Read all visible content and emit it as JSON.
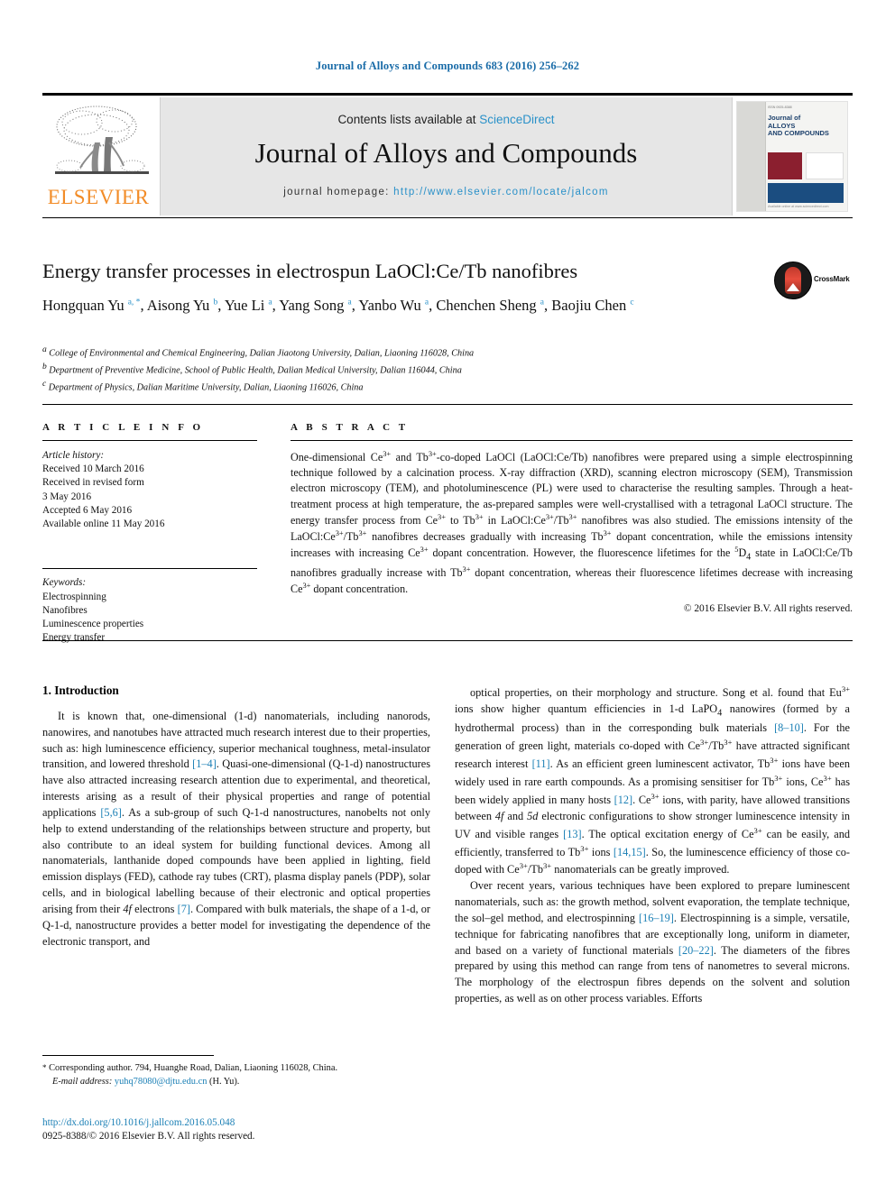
{
  "running_head": "Journal of Alloys and Compounds 683 (2016) 256–262",
  "masthead": {
    "publisher_logo_text": "ELSEVIER",
    "contents_prefix": "Contents lists available at ",
    "contents_link": "ScienceDirect",
    "journal_title": "Journal of Alloys and Compounds",
    "homepage_prefix": "journal homepage: ",
    "homepage_link": "http://www.elsevier.com/locate/jalcom",
    "cover": {
      "top_line": "ISSN 0925-8388",
      "line1": "Journal of",
      "line2": "ALLOYS",
      "line3": "AND COMPOUNDS",
      "foot_line": "Available online at www.sciencedirect.com"
    }
  },
  "article": {
    "title": "Energy transfer processes in electrospun LaOCl:Ce/Tb nanofibres",
    "crossmark_label": "CrossMark",
    "authors": [
      {
        "name": "Hongquan Yu",
        "marks": "a, *"
      },
      {
        "name": "Aisong Yu",
        "marks": "b"
      },
      {
        "name": "Yue Li",
        "marks": "a"
      },
      {
        "name": "Yang Song",
        "marks": "a"
      },
      {
        "name": "Yanbo Wu",
        "marks": "a"
      },
      {
        "name": "Chenchen Sheng",
        "marks": "a"
      },
      {
        "name": "Baojiu Chen",
        "marks": "c"
      }
    ],
    "affiliations": [
      {
        "mark": "a",
        "text": "College of Environmental and Chemical Engineering, Dalian Jiaotong University, Dalian, Liaoning 116028, China"
      },
      {
        "mark": "b",
        "text": "Department of Preventive Medicine, School of Public Health, Dalian Medical University, Dalian 116044, China"
      },
      {
        "mark": "c",
        "text": "Department of Physics, Dalian Maritime University, Dalian, Liaoning 116026, China"
      }
    ]
  },
  "article_info": {
    "heading": "A R T I C L E   I N F O",
    "history_label": "Article history:",
    "history": [
      "Received 10 March 2016",
      "Received in revised form",
      "3 May 2016",
      "Accepted 6 May 2016",
      "Available online 11 May 2016"
    ],
    "keywords_label": "Keywords:",
    "keywords": [
      "Electrospinning",
      "Nanofibres",
      "Luminescence properties",
      "Energy transfer"
    ]
  },
  "abstract": {
    "heading": "A B S T R A C T",
    "text_html": "One-dimensional Ce<sup>3+</sup> and Tb<sup>3+</sup>-co-doped LaOCl (LaOCl:Ce/Tb) nanofibres were prepared using a simple electrospinning technique followed by a calcination process. X-ray diffraction (XRD), scanning electron microscopy (SEM), Transmission electron microscopy (TEM), and photoluminescence (PL) were used to characterise the resulting samples. Through a heat-treatment process at high temperature, the as-prepared samples were well-crystallised with a tetragonal LaOCl structure. The energy transfer process from Ce<sup>3+</sup> to Tb<sup>3+</sup> in LaOCl:Ce<sup>3+</sup>/Tb<sup>3+</sup> nanofibres was also studied. The emissions intensity of the LaOCl:Ce<sup>3+</sup>/Tb<sup>3+</sup> nanofibres decreases gradually with increasing Tb<sup>3+</sup> dopant concentration, while the emissions intensity increases with increasing Ce<sup>3+</sup> dopant concentration. However, the fluorescence lifetimes for the <sup>5</sup>D<sub>4</sub> state in LaOCl:Ce/Tb nanofibres gradually increase with Tb<sup>3+</sup> dopant concentration, whereas their fluorescence lifetimes decrease with increasing Ce<sup>3+</sup> dopant concentration.",
    "copyright": "© 2016 Elsevier B.V. All rights reserved."
  },
  "body": {
    "section_heading": "1.  Introduction",
    "left_paragraphs_html": [
      "It is known that, one-dimensional (1-d) nanomaterials, including nanorods, nanowires, and nanotubes have attracted much research interest due to their properties, such as: high luminescence efficiency, superior mechanical toughness, metal-insulator transition, and lowered threshold <span class=\"ref\">[1–4]</span>. Quasi-one-dimensional (Q-1-d) nanostructures have also attracted increasing research attention due to experimental, and theoretical, interests arising as a result of their physical properties and range of potential applications <span class=\"ref\">[5,6]</span>. As a sub-group of such Q-1-d nanostructures, nanobelts not only help to extend understanding of the relationships between structure and property, but also contribute to an ideal system for building functional devices. Among all nanomaterials, lanthanide doped compounds have been applied in lighting, field emission displays (FED), cathode ray tubes (CRT), plasma display panels (PDP), solar cells, and in biological labelling because of their electronic and optical properties arising from their <span class=\"it\">4f</span> electrons <span class=\"ref\">[7]</span>. Compared with bulk materials, the shape of a 1-d, or Q-1-d, nanostructure provides a better model for investigating the dependence of the electronic transport, and"
    ],
    "right_paragraphs_html": [
      "optical properties, on their morphology and structure. Song et al. found that Eu<sup>3+</sup> ions show higher quantum efficiencies in 1-d LaPO<sub>4</sub> nanowires (formed by a hydrothermal process) than in the corresponding bulk materials <span class=\"ref\">[8–10]</span>. For the generation of green light, materials co-doped with Ce<sup>3+</sup>/Tb<sup>3+</sup> have attracted significant research interest <span class=\"ref\">[11]</span>. As an efficient green luminescent activator, Tb<sup>3+</sup> ions have been widely used in rare earth compounds. As a promising sensitiser for Tb<sup>3+</sup> ions, Ce<sup>3+</sup> has been widely applied in many hosts <span class=\"ref\">[12]</span>. Ce<sup>3+</sup> ions, with parity, have allowed transitions between <span class=\"it\">4f</span> and <span class=\"it\">5d</span> electronic configurations to show stronger luminescence intensity in UV and visible ranges <span class=\"ref\">[13]</span>. The optical excitation energy of Ce<sup>3+</sup> can be easily, and efficiently, transferred to Tb<sup>3+</sup> ions <span class=\"ref\">[14,15]</span>. So, the luminescence efficiency of those co-doped with Ce<sup>3+</sup>/Tb<sup>3+</sup> nanomaterials can be greatly improved.",
      "Over recent years, various techniques have been explored to prepare luminescent nanomaterials, such as: the growth method, solvent evaporation, the template technique, the sol–gel method, and electrospinning <span class=\"ref\">[16–19]</span>. Electrospinning is a simple, versatile, technique for fabricating nanofibres that are exceptionally long, uniform in diameter, and based on a variety of functional materials <span class=\"ref\">[20–22]</span>. The diameters of the fibres prepared by using this method can range from tens of nanometres to several microns. The morphology of the electrospun fibres depends on the solvent and solution properties, as well as on other process variables. Efforts"
    ]
  },
  "footnotes": {
    "corresponding_html": "<span class=\"star\">*</span> Corresponding author. 794, Huanghe Road, Dalian, Liaoning 116028, China.",
    "email_label": "E-mail address:",
    "email": "yuhq78080@djtu.edu.cn",
    "email_suffix": "(H. Yu).",
    "doi": "http://dx.doi.org/10.1016/j.jallcom.2016.05.048",
    "issn_line": "0925-8388/© 2016 Elsevier B.V. All rights reserved."
  },
  "colors": {
    "link_blue": "#1a7fb5",
    "sciencedirect_blue": "#2a91c9",
    "elsevier_orange": "#f28c28",
    "runhead_blue": "#1a6ca8"
  }
}
